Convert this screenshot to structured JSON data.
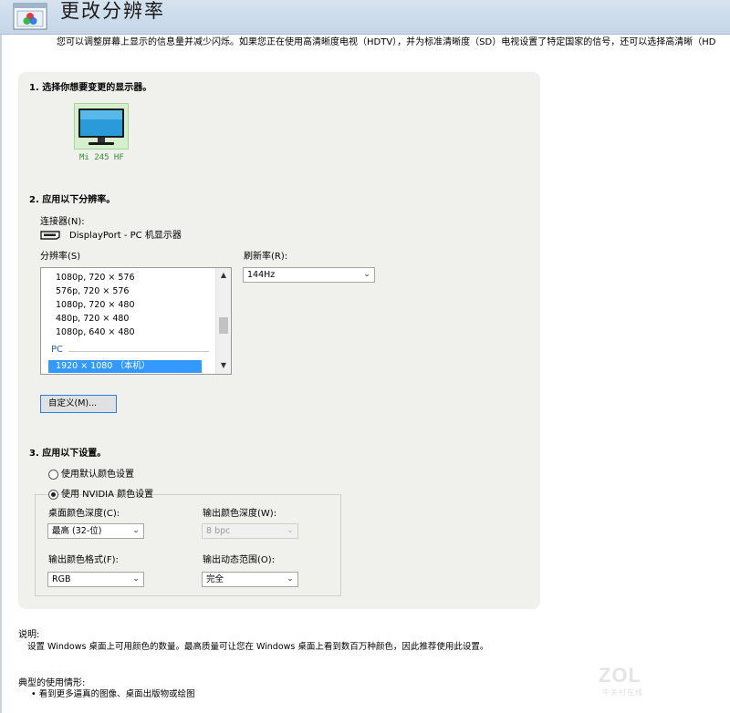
{
  "header": {
    "title": "更改分辨率"
  },
  "intro": "您可以调整屏幕上显示的信息量并减少闪烁。如果您正在使用高清晰度电视（HDTV），并为标准清晰度（SD）电视设置了特定国家的信号，还可以选择高清晰（HD",
  "section1": {
    "heading": "1.  选择你想要变更的显示器。",
    "monitor_label": "Mi 245 HF"
  },
  "section2": {
    "heading": "2.  应用以下分辨率。",
    "connector_label": "连接器(N):",
    "connector_value": "DisplayPort - PC 机显示器",
    "resolution_label": "分辨率(S)",
    "refresh_label": "刷新率(R):",
    "refresh_value": "144Hz",
    "resolutions": [
      "1080p, 720 × 576",
      "576p, 720 × 576",
      "1080p, 720 × 480",
      "480p, 720 × 480",
      "1080p, 640 × 480"
    ],
    "pc_group": "PC",
    "selected_resolution": "1920 × 1080 （本机）",
    "custom_button": "自定义(M)..."
  },
  "section3": {
    "heading": "3.  应用以下设置。",
    "radio_default": "使用默认颜色设置",
    "radio_nvidia": "使用 NVIDIA 颜色设置",
    "desktop_depth_label": "桌面颜色深度(C):",
    "desktop_depth_value": "最高 (32-位)",
    "output_depth_label": "输出颜色深度(W):",
    "output_depth_value": "8 bpc",
    "output_format_label": "输出颜色格式(F):",
    "output_format_value": "RGB",
    "output_range_label": "输出动态范围(O):",
    "output_range_value": "完全"
  },
  "description": {
    "heading": "说明:",
    "text": "设置 Windows 桌面上可用颜色的数量。最高质量可让您在 Windows 桌面上看到数百万种颜色，因此推荐使用此设置。"
  },
  "usage": {
    "heading": "典型的使用情形:",
    "item": "•  看到更多逼真的图像、桌面出版物或绘图"
  },
  "watermark": {
    "logo": "ZOL",
    "sub": "中关村在线"
  },
  "colors": {
    "selection": "#3399ff",
    "monitor_bg": "#d4f0cc",
    "monitor_text": "#2f8f2f",
    "pc_group": "#2a5fbf"
  }
}
